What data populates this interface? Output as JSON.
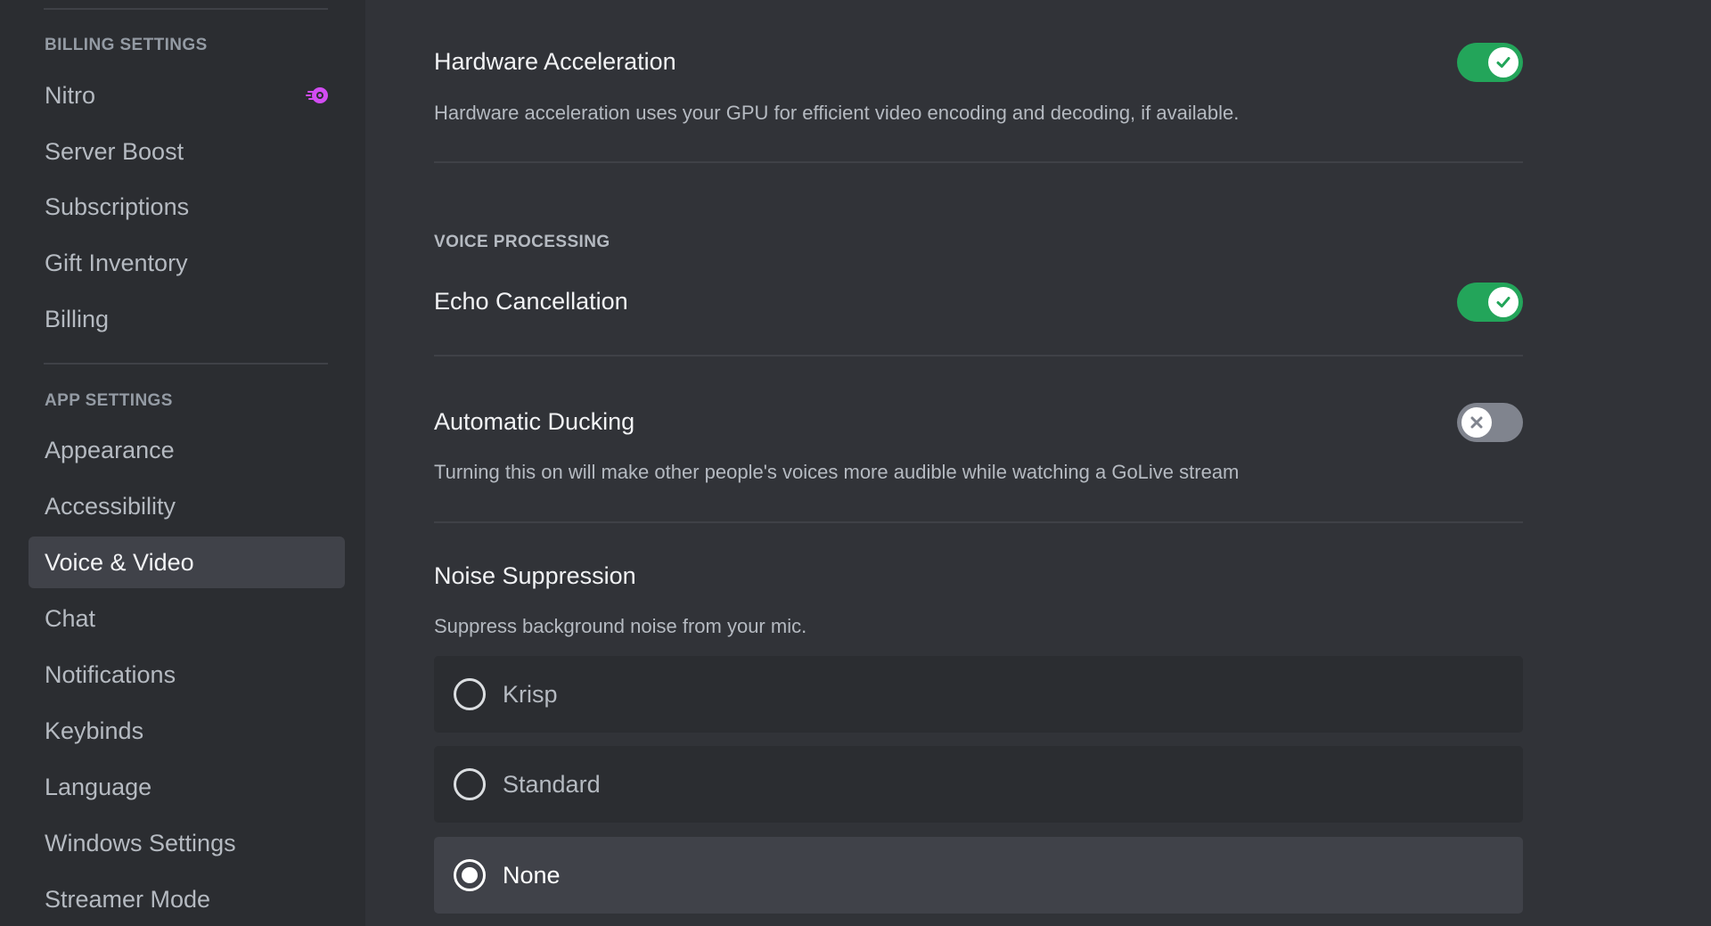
{
  "sidebar": {
    "sections": [
      {
        "header": "BILLING SETTINGS",
        "items": [
          {
            "label": "Nitro",
            "icon": "nitro-icon"
          },
          {
            "label": "Server Boost"
          },
          {
            "label": "Subscriptions"
          },
          {
            "label": "Gift Inventory"
          },
          {
            "label": "Billing"
          }
        ]
      },
      {
        "header": "APP SETTINGS",
        "items": [
          {
            "label": "Appearance"
          },
          {
            "label": "Accessibility"
          },
          {
            "label": "Voice & Video",
            "selected": true
          },
          {
            "label": "Chat"
          },
          {
            "label": "Notifications"
          },
          {
            "label": "Keybinds"
          },
          {
            "label": "Language"
          },
          {
            "label": "Windows Settings"
          },
          {
            "label": "Streamer Mode"
          }
        ]
      }
    ]
  },
  "main": {
    "hardware_acceleration": {
      "title": "Hardware Acceleration",
      "description": "Hardware acceleration uses your GPU for efficient video encoding and decoding, if available.",
      "enabled": true
    },
    "voice_processing": {
      "header": "VOICE PROCESSING",
      "echo_cancellation": {
        "title": "Echo Cancellation",
        "enabled": true
      },
      "automatic_ducking": {
        "title": "Automatic Ducking",
        "description": "Turning this on will make other people's voices more audible while watching a GoLive stream",
        "enabled": false
      },
      "noise_suppression": {
        "title": "Noise Suppression",
        "description": "Suppress background noise from your mic.",
        "options": [
          {
            "label": "Krisp",
            "selected": false
          },
          {
            "label": "Standard",
            "selected": false
          },
          {
            "label": "None",
            "selected": true
          }
        ]
      }
    }
  },
  "colors": {
    "toggle_on": "#23a55a",
    "toggle_off": "#80848e",
    "nitro": "#d24cf2"
  }
}
